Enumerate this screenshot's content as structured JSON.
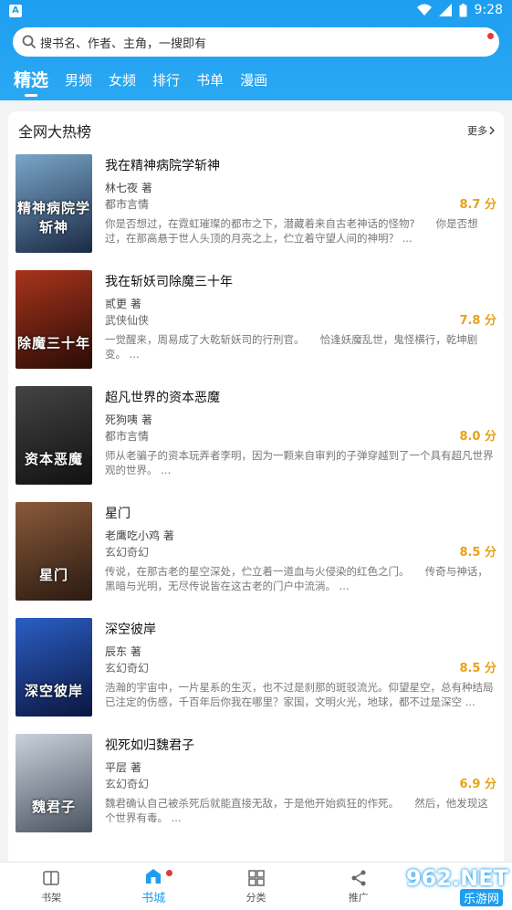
{
  "status_bar": {
    "app_badge": "A",
    "time": "9:28"
  },
  "search": {
    "placeholder": "搜书名、作者、主角，一搜即有"
  },
  "tabs": [
    {
      "label": "精选"
    },
    {
      "label": "男频"
    },
    {
      "label": "女频"
    },
    {
      "label": "排行"
    },
    {
      "label": "书单"
    },
    {
      "label": "漫画"
    }
  ],
  "section": {
    "title": "全网大热榜",
    "more_label": "更多"
  },
  "books": [
    {
      "title": "我在精神病院学斩神",
      "author": "林七夜 著",
      "genre": "都市言情",
      "score": "8.7 分",
      "desc": "你是否想过，在霓虹璀璨的都市之下，潜藏着来自古老神话的怪物?　　你是否想过，在那高悬于世人头顶的月亮之上，伫立着守望人间的神明？ ...",
      "cover_text": "精神病院学斩神",
      "cover_colors": [
        "#7aa6c9",
        "#1a2a44"
      ]
    },
    {
      "title": "我在斩妖司除魔三十年",
      "author": "贰更 著",
      "genre": "武侠仙侠",
      "score": "7.8 分",
      "desc": "一觉醒来，周易成了大乾斩妖司的行刑官。　　恰逢妖魔乱世，鬼怪横行，乾坤剧变。 ...",
      "cover_text": "除魔三十年",
      "cover_colors": [
        "#a8341c",
        "#2a0c06"
      ]
    },
    {
      "title": "超凡世界的资本恶魔",
      "author": "死狗咦 著",
      "genre": "都市言情",
      "score": "8.0 分",
      "desc": "师从老骗子的资本玩弄者李明，因为一颗来自审判的子弹穿越到了一个具有超凡世界观的世界。 ...",
      "cover_text": "资本恶魔",
      "cover_colors": [
        "#444444",
        "#111111"
      ]
    },
    {
      "title": "星门",
      "author": "老鹰吃小鸡 著",
      "genre": "玄幻奇幻",
      "score": "8.5 分",
      "desc": "传说，在那古老的星空深处，伫立着一道血与火侵染的红色之门。　　传奇与神话，黑暗与光明，无尽传说皆在这古老的门户中流淌。 ...",
      "cover_text": "星门",
      "cover_colors": [
        "#8a5a3a",
        "#2a1a12"
      ]
    },
    {
      "title": "深空彼岸",
      "author": "辰东 著",
      "genre": "玄幻奇幻",
      "score": "8.5 分",
      "desc": "浩瀚的宇宙中，一片星系的生灭，也不过是刹那的斑驳流光。仰望星空，总有种结局已注定的伤感，千百年后你我在哪里？家国，文明火光，地球，都不过是深空 ...",
      "cover_text": "深空彼岸",
      "cover_colors": [
        "#2b5fc4",
        "#0b1640"
      ]
    },
    {
      "title": "视死如归魏君子",
      "author": "平层 著",
      "genre": "玄幻奇幻",
      "score": "6.9 分",
      "desc": "魏君确认自己被杀死后就能直接无敌，于是他开始疯狂的作死。　　然后，他发现这个世界有毒。 ...",
      "cover_text": "魏君子",
      "cover_colors": [
        "#c9d2dc",
        "#4a5360"
      ]
    }
  ],
  "bottom_nav": [
    {
      "label": "书架",
      "icon": "book-icon"
    },
    {
      "label": "书城",
      "icon": "home-icon"
    },
    {
      "label": "分类",
      "icon": "grid-icon"
    },
    {
      "label": "推广",
      "icon": "share-icon"
    }
  ],
  "watermark": {
    "text": "962.NET",
    "sub": "乐游网"
  },
  "colors": {
    "accent": "#1e9ef0",
    "score": "#e6a21a",
    "dot": "#e53935"
  }
}
